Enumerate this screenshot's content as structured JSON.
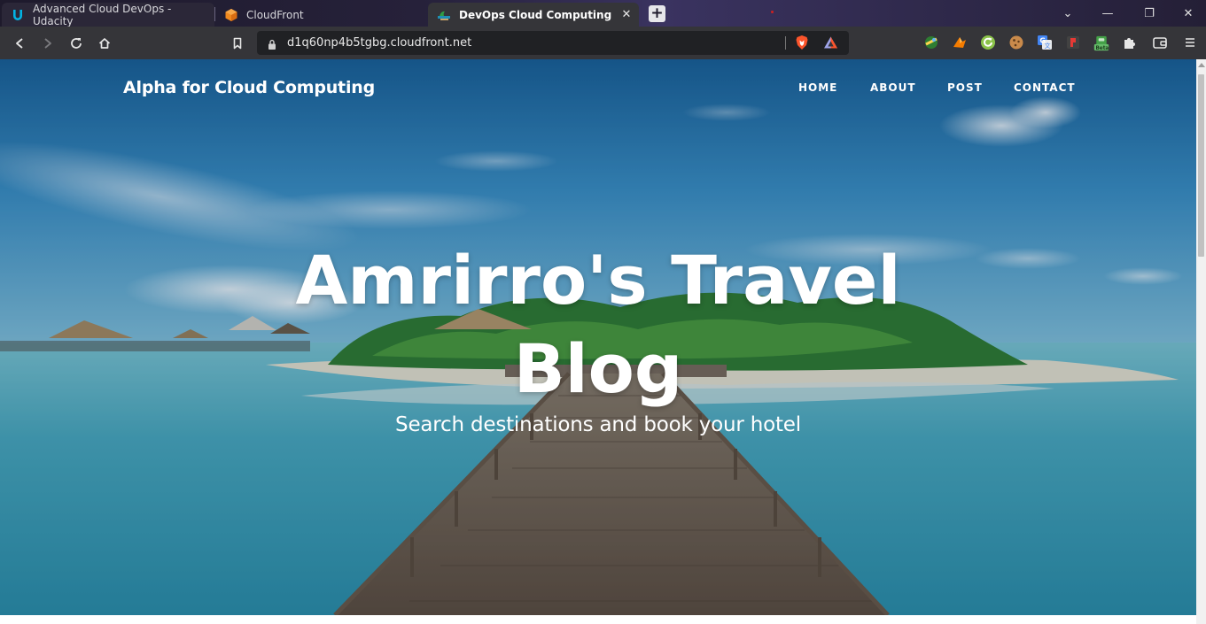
{
  "browser": {
    "tabs": [
      {
        "title": "Advanced Cloud DevOps - Udacity",
        "favicon": "udacity-icon",
        "active": false
      },
      {
        "title": "CloudFront",
        "favicon": "aws-cube-icon",
        "active": false
      },
      {
        "title": "DevOps Cloud Computing",
        "favicon": "site-icon",
        "active": true
      }
    ],
    "close_tab_glyph": "✕",
    "new_tab_glyph": "+",
    "window_controls": {
      "dropdown": "⌄",
      "minimize": "—",
      "restore": "❐",
      "close": "✕"
    },
    "url": "d1q60np4b5tgbg.cloudfront.net",
    "extensions": [
      "brave-shield-icon",
      "brave-rewards-icon",
      "globe-extension-icon",
      "fox-extension-icon",
      "green-refresh-icon",
      "cookie-icon",
      "translate-icon",
      "red-tag-icon",
      "beta-extension-icon",
      "puzzle-icon",
      "wallet-icon",
      "menu-icon"
    ],
    "beta_label": "Beta"
  },
  "site": {
    "brand": "Alpha for Cloud Computing",
    "nav": [
      {
        "label": "HOME"
      },
      {
        "label": "ABOUT"
      },
      {
        "label": "POST"
      },
      {
        "label": "CONTACT"
      }
    ],
    "headline_line1": "Amrirro's Travel",
    "headline_line2": "Blog",
    "subheading": "Search destinations and book your hotel"
  },
  "colors": {
    "tabstrip": "#1e1a2c",
    "toolbar": "#353539",
    "urlbar": "#202124",
    "brave_orange": "#fb542b"
  }
}
